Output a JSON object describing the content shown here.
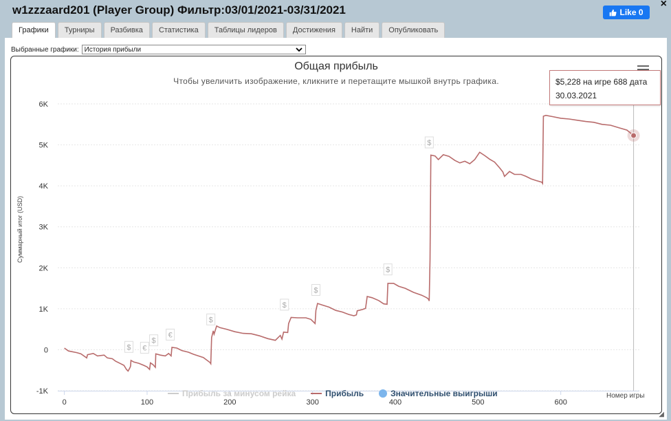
{
  "window": {
    "title": "w1zzzaard201 (Player Group) Фильтр:03/01/2021-03/31/2021",
    "close_label": "×",
    "fb_like_label": "Like 0"
  },
  "tabs": [
    {
      "label": "Графики",
      "active": true
    },
    {
      "label": "Турниры",
      "active": false
    },
    {
      "label": "Разбивка",
      "active": false
    },
    {
      "label": "Статистика",
      "active": false
    },
    {
      "label": "Таблицы лидеров",
      "active": false
    },
    {
      "label": "Достижения",
      "active": false
    },
    {
      "label": "Найти",
      "active": false
    },
    {
      "label": "Опубликовать",
      "active": false
    }
  ],
  "selector": {
    "label": "Выбранные графики:",
    "value": "История прибыли"
  },
  "colors": {
    "profit_line": "#b86b6b",
    "rake_line": "#cccccc",
    "big_wins": "#7cb5ec",
    "tooltip_border": "#c47a7a"
  },
  "tooltip": {
    "line1": "$5,228 на игре 688 дата",
    "line2": "30.03.2021"
  },
  "chart_data": {
    "type": "line",
    "title": "Общая прибыль",
    "subtitle": "Чтобы увеличить изображение, кликните и перетащите мышкой внутрь графика.",
    "xlabel": "Номер игры",
    "ylabel": "Суммарный итог (USD)",
    "xlim": [
      -8,
      695
    ],
    "ylim": [
      -1000,
      6000
    ],
    "x_ticks": [
      "0",
      "100",
      "200",
      "300",
      "400",
      "500",
      "600"
    ],
    "y_ticks": [
      "-1K",
      "0",
      "1K",
      "2K",
      "3K",
      "4K",
      "5K",
      "6K"
    ],
    "y_tick_values": [
      -1000,
      0,
      1000,
      2000,
      3000,
      4000,
      5000,
      6000
    ],
    "x_tick_values": [
      0,
      100,
      200,
      300,
      400,
      500,
      600
    ],
    "grid": true,
    "legend_position": "bottom",
    "series": [
      {
        "name": "Прибыль за минусом рейка",
        "color": "#cccccc",
        "values": []
      },
      {
        "name": "Прибыль",
        "color": "#b86b6b",
        "points": [
          [
            0,
            40
          ],
          [
            5,
            -30
          ],
          [
            15,
            -70
          ],
          [
            20,
            -100
          ],
          [
            27,
            -200
          ],
          [
            28,
            -120
          ],
          [
            35,
            -90
          ],
          [
            40,
            -150
          ],
          [
            48,
            -130
          ],
          [
            52,
            -200
          ],
          [
            58,
            -220
          ],
          [
            62,
            -280
          ],
          [
            68,
            -340
          ],
          [
            72,
            -380
          ],
          [
            75,
            -480
          ],
          [
            77,
            -520
          ],
          [
            79,
            -450
          ],
          [
            80,
            -400
          ],
          [
            80.5,
            -260
          ],
          [
            84,
            -300
          ],
          [
            90,
            -330
          ],
          [
            96,
            -380
          ],
          [
            100,
            -420
          ],
          [
            103,
            -480
          ],
          [
            104,
            -320
          ],
          [
            107,
            -360
          ],
          [
            110,
            -430
          ],
          [
            110.5,
            -100
          ],
          [
            116,
            -130
          ],
          [
            122,
            -150
          ],
          [
            126,
            -90
          ],
          [
            129,
            -150
          ],
          [
            130,
            60
          ],
          [
            136,
            40
          ],
          [
            142,
            -20
          ],
          [
            150,
            -60
          ],
          [
            156,
            -110
          ],
          [
            162,
            -150
          ],
          [
            168,
            -190
          ],
          [
            176,
            -310
          ],
          [
            177,
            -340
          ],
          [
            178,
            300
          ],
          [
            180,
            460
          ],
          [
            181,
            380
          ],
          [
            184,
            580
          ],
          [
            188,
            540
          ],
          [
            196,
            500
          ],
          [
            206,
            440
          ],
          [
            216,
            400
          ],
          [
            226,
            390
          ],
          [
            236,
            340
          ],
          [
            246,
            270
          ],
          [
            255,
            230
          ],
          [
            261,
            350
          ],
          [
            263,
            260
          ],
          [
            265,
            430
          ],
          [
            270,
            420
          ],
          [
            271,
            640
          ],
          [
            274,
            790
          ],
          [
            282,
            780
          ],
          [
            292,
            780
          ],
          [
            298,
            740
          ],
          [
            303,
            640
          ],
          [
            304,
            960
          ],
          [
            306,
            1130
          ],
          [
            312,
            1090
          ],
          [
            320,
            1040
          ],
          [
            328,
            960
          ],
          [
            336,
            920
          ],
          [
            344,
            860
          ],
          [
            350,
            830
          ],
          [
            353,
            850
          ],
          [
            354,
            950
          ],
          [
            360,
            980
          ],
          [
            364,
            1010
          ],
          [
            366,
            1300
          ],
          [
            372,
            1270
          ],
          [
            380,
            1200
          ],
          [
            386,
            1120
          ],
          [
            390,
            1110
          ],
          [
            391,
            1620
          ],
          [
            398,
            1620
          ],
          [
            404,
            1550
          ],
          [
            412,
            1500
          ],
          [
            422,
            1400
          ],
          [
            432,
            1330
          ],
          [
            438,
            1270
          ],
          [
            440,
            1240
          ],
          [
            441,
            1190
          ],
          [
            442,
            2200
          ],
          [
            443,
            4750
          ],
          [
            448,
            4730
          ],
          [
            452,
            4640
          ],
          [
            458,
            4760
          ],
          [
            465,
            4720
          ],
          [
            472,
            4620
          ],
          [
            478,
            4560
          ],
          [
            484,
            4600
          ],
          [
            490,
            4540
          ],
          [
            496,
            4640
          ],
          [
            502,
            4820
          ],
          [
            508,
            4740
          ],
          [
            514,
            4650
          ],
          [
            520,
            4580
          ],
          [
            526,
            4440
          ],
          [
            530,
            4340
          ],
          [
            532,
            4230
          ],
          [
            538,
            4350
          ],
          [
            544,
            4280
          ],
          [
            552,
            4280
          ],
          [
            558,
            4230
          ],
          [
            564,
            4170
          ],
          [
            570,
            4130
          ],
          [
            577,
            4090
          ],
          [
            578,
            4060
          ],
          [
            579,
            5700
          ],
          [
            582,
            5720
          ],
          [
            590,
            5690
          ],
          [
            600,
            5650
          ],
          [
            610,
            5630
          ],
          [
            620,
            5600
          ],
          [
            630,
            5570
          ],
          [
            640,
            5550
          ],
          [
            650,
            5500
          ],
          [
            660,
            5480
          ],
          [
            670,
            5420
          ],
          [
            680,
            5360
          ],
          [
            688,
            5228
          ]
        ]
      },
      {
        "name": "Значительные выигрыши",
        "color": "#7cb5ec",
        "markers": [
          {
            "x": 78,
            "y": 70,
            "symbol": "$"
          },
          {
            "x": 97,
            "y": 50,
            "symbol": "€"
          },
          {
            "x": 108,
            "y": 230,
            "symbol": "$"
          },
          {
            "x": 128,
            "y": 370,
            "symbol": "€"
          },
          {
            "x": 177,
            "y": 740,
            "symbol": "$"
          },
          {
            "x": 266,
            "y": 1100,
            "symbol": "$"
          },
          {
            "x": 304,
            "y": 1460,
            "symbol": "$"
          },
          {
            "x": 391,
            "y": 1960,
            "symbol": "$"
          },
          {
            "x": 441,
            "y": 5060,
            "symbol": "$"
          }
        ]
      }
    ]
  }
}
